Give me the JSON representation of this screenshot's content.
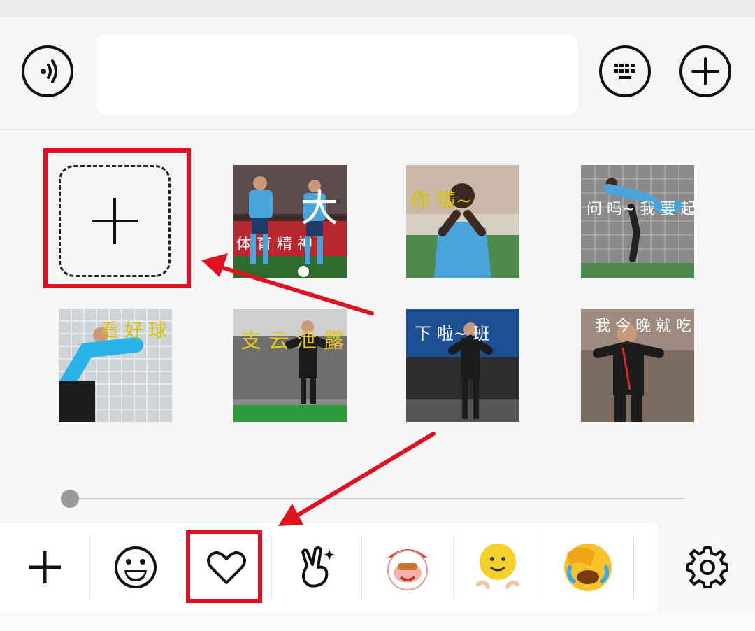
{
  "input_bar": {
    "voice_button": "voice-icon",
    "text_field_value": "",
    "keyboard_button": "keyboard-icon",
    "more_button": "plus-circle-icon"
  },
  "sticker_panel": {
    "add_tile_icon": "plus-icon",
    "stickers": [
      {
        "name": "sticker-1",
        "caption": "大"
      },
      {
        "name": "sticker-2",
        "caption": "你 懂~"
      },
      {
        "name": "sticker-3",
        "caption": "问 吗~ 我 要 起 飞 啦~"
      },
      {
        "name": "sticker-4",
        "caption": "看 好 球 又 大 又 圆~"
      },
      {
        "name": "sticker-5",
        "caption": "支 云 泄 露"
      },
      {
        "name": "sticker-6",
        "caption": "下 啦~ 班"
      },
      {
        "name": "sticker-7",
        "caption": "我 今 晚 就 吃 公 多"
      }
    ],
    "background_text": "体 育 精 神"
  },
  "tabs": [
    {
      "name": "add-tab",
      "icon": "plus-icon"
    },
    {
      "name": "emoji-tab",
      "icon": "smiley-icon"
    },
    {
      "name": "favorites-tab",
      "icon": "heart-icon",
      "selected": true
    },
    {
      "name": "stickers-tab",
      "icon": "victory-hand-icon"
    },
    {
      "name": "pack-clown-tab",
      "icon": "clown-sticker-icon"
    },
    {
      "name": "pack-smiley-tab",
      "icon": "waving-smiley-icon"
    },
    {
      "name": "pack-laughing-tab",
      "icon": "facepalm-laugh-icon"
    },
    {
      "name": "settings-tab",
      "icon": "gear-icon"
    }
  ],
  "colors": {
    "annotation_red": "#e0101e",
    "background": "#f6f6f6",
    "icon_dark": "#111111"
  }
}
